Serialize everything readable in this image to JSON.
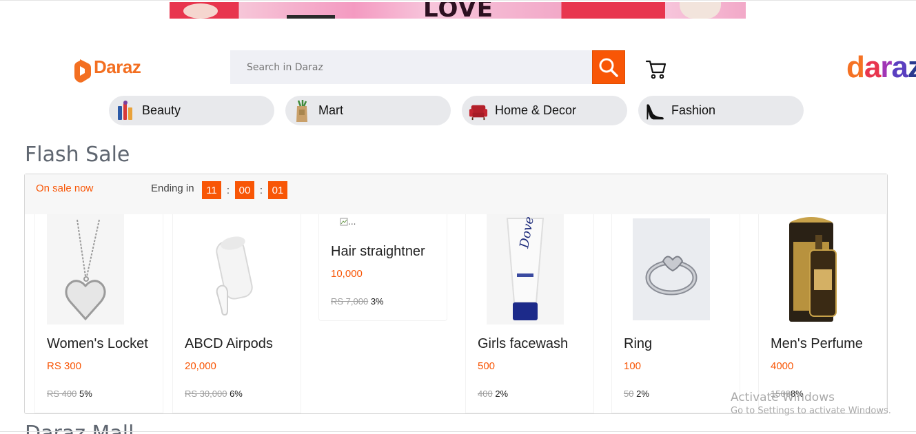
{
  "banner": {
    "headline": "LOVE"
  },
  "header": {
    "logo_text": "Daraz",
    "search_placeholder": "Search in Daraz",
    "brand_logo": "daraz",
    "icons": {
      "search": "search-icon",
      "cart": "cart-icon"
    }
  },
  "categories": [
    {
      "label": "Beauty",
      "icon": "beauty-icon"
    },
    {
      "label": "Mart",
      "icon": "mart-icon"
    },
    {
      "label": "Home & Decor",
      "icon": "home-decor-icon"
    },
    {
      "label": "Fashion",
      "icon": "fashion-icon"
    }
  ],
  "flash_sale": {
    "title": "Flash Sale",
    "on_sale_label": "On sale now",
    "ending_label": "Ending in",
    "timer": {
      "hours": "11",
      "minutes": "00",
      "seconds": "01",
      "separator": ":"
    },
    "products": [
      {
        "name": "Women's Locket",
        "price": "RS 300",
        "original_price": "RS 400",
        "discount": "5%"
      },
      {
        "name": "ABCD Airpods",
        "price": "20,000",
        "original_price": "RS 30,000",
        "discount": "6%"
      },
      {
        "name": "Hair straightner",
        "price": "10,000",
        "original_price": "RS 7,000",
        "discount": "3%",
        "image_alt": "..."
      },
      {
        "name": "Girls facewash",
        "price": "500",
        "original_price": "400",
        "discount": "2%"
      },
      {
        "name": "Ring",
        "price": "100",
        "original_price": "50",
        "discount": "2%"
      },
      {
        "name": "Men's Perfume",
        "price": "4000",
        "original_price": "1500",
        "discount": "8%"
      }
    ]
  },
  "next_section_title": "Daraz Mall",
  "watermark": {
    "line1": "Activate Windows",
    "line2": "Go to Settings to activate Windows."
  },
  "colors": {
    "accent": "#f85606",
    "section_title": "#5f6670",
    "category_bg": "#e8e9ec"
  }
}
